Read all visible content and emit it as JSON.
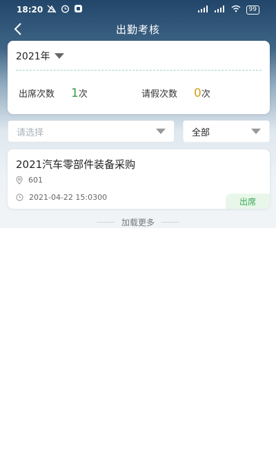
{
  "status_bar": {
    "time": "18:20",
    "battery": "99"
  },
  "nav": {
    "title": "出勤考核",
    "back_icon": "back-arrow-icon"
  },
  "summary": {
    "year": "2021年",
    "attendance_label": "出席次数",
    "attendance_count": "1",
    "attendance_unit": "次",
    "leave_label": "请假次数",
    "leave_count": "0",
    "leave_unit": "次",
    "colors": {
      "attendance": "#2f9e44",
      "leave": "#d4a017"
    }
  },
  "filters": {
    "select_placeholder": "请选择",
    "status_value": "全部"
  },
  "records": [
    {
      "title": "2021汽车零部件装备采购",
      "location": "601",
      "datetime": "2021-04-22 15:0300",
      "status": "出席"
    }
  ],
  "load_more": "加载更多"
}
